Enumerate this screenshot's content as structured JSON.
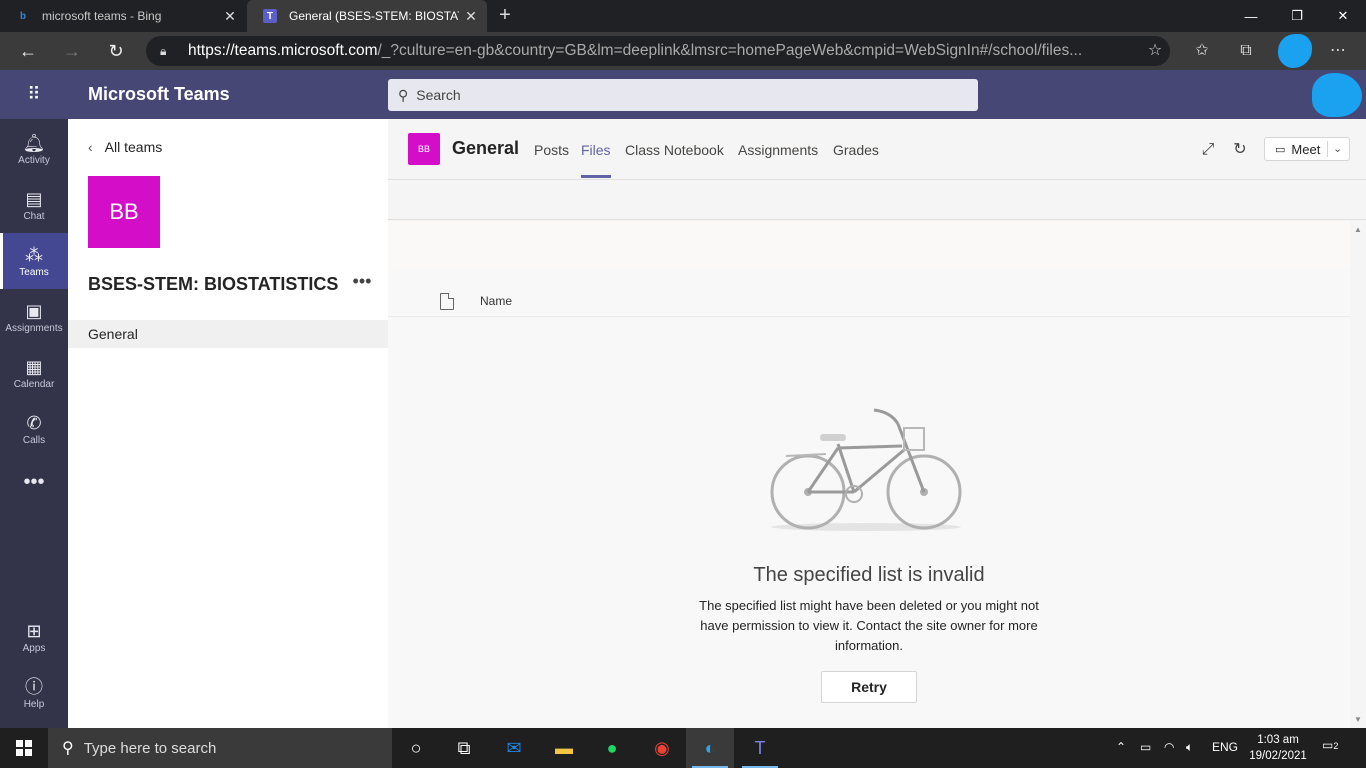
{
  "browser": {
    "tabs": [
      {
        "title": "microsoft teams - Bing",
        "favicon": "bing-icon"
      },
      {
        "title": "General (BSES-STEM: BIOSTATIST",
        "favicon": "teams-icon"
      }
    ],
    "url_host": "https://teams.microsoft.com",
    "url_rest": "/_?culture=en-gb&country=GB&lm=deeplink&lmsrc=homePageWeb&cmpid=WebSignIn#/school/files..."
  },
  "teams": {
    "app_title": "Microsoft Teams",
    "search_placeholder": "Search"
  },
  "rail": {
    "items": [
      {
        "label": "Activity",
        "icon": "bell-icon"
      },
      {
        "label": "Chat",
        "icon": "chat-icon"
      },
      {
        "label": "Teams",
        "icon": "teams-icon",
        "active": true
      },
      {
        "label": "Assignments",
        "icon": "assignments-icon"
      },
      {
        "label": "Calendar",
        "icon": "calendar-icon"
      },
      {
        "label": "Calls",
        "icon": "phone-icon"
      },
      {
        "label": "Apps",
        "icon": "apps-icon"
      },
      {
        "label": "Help",
        "icon": "help-icon"
      }
    ]
  },
  "team_panel": {
    "back_label": "All teams",
    "avatar_initials": "BB",
    "team_name": "BSES-STEM: BIOSTATISTICS",
    "channels": [
      "General"
    ]
  },
  "channel": {
    "avatar_initials": "BB",
    "title": "General",
    "tabs": [
      "Posts",
      "Files",
      "Class Notebook",
      "Assignments",
      "Grades"
    ],
    "active_tab": "Files",
    "meet_label": "Meet"
  },
  "files": {
    "column_name": "Name",
    "error_title": "The specified list is invalid",
    "error_body": "The specified list might have been deleted or you might not have permission to view it. Contact the site owner for more information.",
    "retry_label": "Retry"
  },
  "taskbar": {
    "search_placeholder": "Type here to search",
    "language": "ENG",
    "time": "1:03 am",
    "date": "19/02/2021",
    "notification_count": "2"
  },
  "colors": {
    "teams_header": "#464775",
    "rail": "#33344a",
    "accent": "#6264a7",
    "team_avatar": "#d40ec8"
  }
}
